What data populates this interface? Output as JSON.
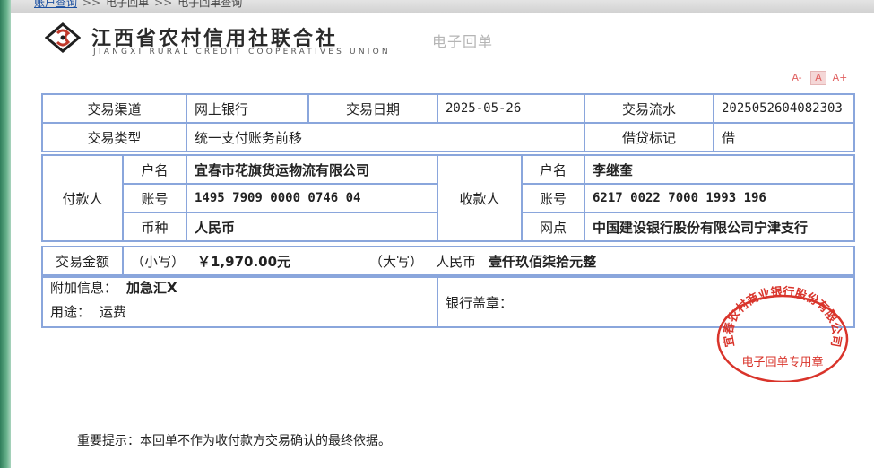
{
  "breadcrumb": {
    "items": [
      "账户查询",
      "电子回单",
      "电子回单查询"
    ],
    "separator": ">>"
  },
  "header": {
    "org_name": "江西省农村信用社联合社",
    "org_name_en": "JIANGXI RURAL CREDIT COOPERATIVES UNION",
    "receipt_title": "电子回单"
  },
  "font_controls": {
    "decrease": "A-",
    "normal": "A",
    "increase": "A+"
  },
  "receipt": {
    "channel_label": "交易渠道",
    "channel_value": "网上银行",
    "date_label": "交易日期",
    "date_value": "2025-05-26",
    "serial_label": "交易流水",
    "serial_value": "2025052604082303",
    "type_label": "交易类型",
    "type_value": "统一支付账务前移",
    "dc_label": "借贷标记",
    "dc_value": "借",
    "payer_label": "付款人",
    "payee_label": "收款人",
    "name_label": "户名",
    "account_label": "账号",
    "currency_label": "币种",
    "branch_label": "网点",
    "payer_name": "宜春市花旗货运物流有限公司",
    "payer_account": "1495 7909 0000 0746 04",
    "payer_currency": "人民币",
    "payee_name": "李继奎",
    "payee_account": "6217 0022 7000 1993 196",
    "payee_branch": "中国建设银行股份有限公司宁津支行",
    "amount_label": "交易金额",
    "amount_small_label": "（小写）",
    "amount_small_value": "￥1,970.00元",
    "amount_big_label": "（大写）",
    "amount_big_currency": "人民币",
    "amount_big_value": "壹仟玖佰柒拾元整",
    "extra_info_label": "附加信息：",
    "extra_info_value": "加急汇X",
    "purpose_label": "用途：",
    "purpose_value": "运费",
    "bank_seal_label": "银行盖章："
  },
  "stamp": {
    "text_arc": "宜春农村商业银行股份有限公司",
    "text_center": "电子回单专用章",
    "color": "#d9342b"
  },
  "notice": "重要提示：本回单不作为收付款方交易确认的最终依据。",
  "colors": {
    "border": "#8aa6dc",
    "brand_green": "#2e7d5a"
  }
}
